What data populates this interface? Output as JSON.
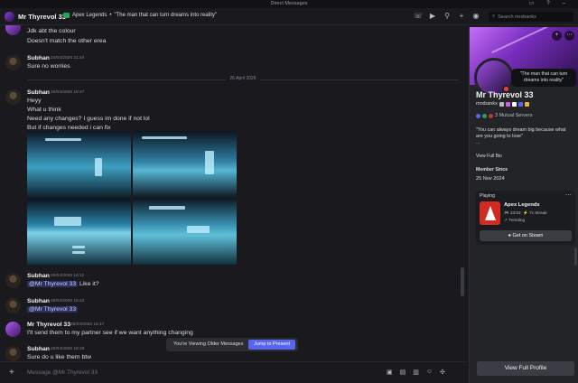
{
  "titlebar": {
    "title": "Direct Messages"
  },
  "header": {
    "name": "Mr Thyrevol",
    "badge": "33",
    "game": "Apex Legends",
    "status_quote": "\"The man that can turn dreams into reality\"",
    "search_placeholder": "Search mrxbankx"
  },
  "messages": [
    {
      "line": "Jdk abt the colour"
    },
    {
      "line": "Doesn't match the other erea"
    },
    {
      "author": "Subhan",
      "time": "24/04/2026 21:44",
      "lines": [
        "Sure no worries"
      ]
    },
    {
      "date_divider": "26 April 2026"
    },
    {
      "author": "Subhan",
      "time": "26/04/2026 15:47",
      "lines": [
        "Heyy",
        "What u think",
        "Need any changes? I guess im done if not lol",
        "But if changes needed i can fix"
      ]
    },
    {
      "author": "Subhan",
      "time": "26/04/2026 16:12",
      "mention": "@Mr Thyrevol 33",
      "text": "Like it?"
    },
    {
      "author": "Subhan",
      "time": "26/04/2026 16:12",
      "mention": "@Mr Thyrevol 33"
    },
    {
      "author": "Mr Thyrevol",
      "badge": "33",
      "time": "26/04/2026 16:17",
      "lines": [
        "I'll send them to my partner see if we want anything changing"
      ]
    },
    {
      "author": "Subhan",
      "time": "26/04/2026 16:19",
      "lines": [
        "Sure do u like them btw"
      ]
    }
  ],
  "older_bar": {
    "label": "You're Viewing Older Messages",
    "button": "Jump to Present"
  },
  "composer": {
    "placeholder": "Message @Mr Thyrevol 33"
  },
  "profile": {
    "status_bubble": "\"The man that can turn dreams into reality\"",
    "name": "Mr Thyrevol",
    "badge": "33",
    "username": "mrxbankx",
    "mutual": "3 Mutual Servers",
    "bio": "\"You can always dream big because what are you going to lose\"",
    "bio_more": "...",
    "view_full_bio": "View Full Bio",
    "member_since_label": "Member Since",
    "member_since": "25 Nov 2024",
    "playing_label": "Playing",
    "game": "Apex Legends",
    "game_time": "33:53",
    "game_streak": "7x Streak",
    "game_trending": "Trending",
    "steam_button": "Get on Steam",
    "full_profile_button": "View Full Profile"
  },
  "colors": {
    "accent": "#5865f2",
    "background": "#1a1a1e",
    "panel": "#232428",
    "dnd": "#f23f43",
    "banner": "#7a2fc0"
  }
}
